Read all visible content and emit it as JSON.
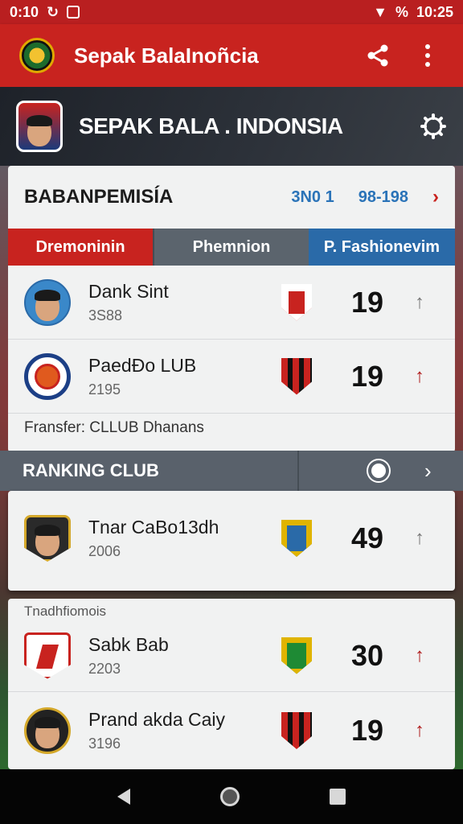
{
  "status_bar": {
    "time_left": "0:10",
    "battery_text": "%",
    "time_right": "10:25"
  },
  "app_bar": {
    "title": "Sepak BalaInoñcia"
  },
  "banner": {
    "title": "SEPAK BALA . INDONSIA"
  },
  "section": {
    "title": "BABANPEMISÍA",
    "meta_1": "3N0 1",
    "meta_2": "98-198",
    "chevron": "›"
  },
  "tabs": [
    {
      "label": "Dremoninin"
    },
    {
      "label": "Phemnion"
    },
    {
      "label": "P. Fashionevim"
    }
  ],
  "players": [
    {
      "name": "Dank Sint",
      "sub": "3S88",
      "score": "19",
      "arrow": "↑"
    },
    {
      "name": "PaedĐo LUB",
      "sub": "2195",
      "score": "19",
      "arrow": "↑"
    }
  ],
  "transfer_text": "Fransfer: CLLUB Dhanans",
  "ranking": {
    "title": "RANKING CLUB",
    "chevron": "›"
  },
  "featured": {
    "name": "Tnar CaBo13dh",
    "sub": "2006",
    "score": "49",
    "arrow": "↑"
  },
  "bottom_label": "Tnadhfiomois",
  "bottom_rows": [
    {
      "name": "Sabk Bab",
      "sub": "2203",
      "score": "30",
      "arrow": "↑"
    },
    {
      "name": "Prand akda Caiy",
      "sub": "3196",
      "score": "19",
      "arrow": "↑"
    }
  ],
  "colors": {
    "brand_red": "#c8231f",
    "tab_grey": "#5b646d",
    "tab_blue": "#2a6aa8"
  }
}
